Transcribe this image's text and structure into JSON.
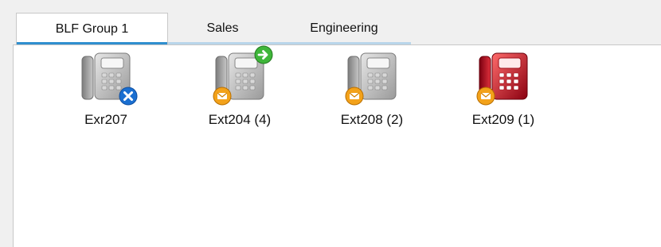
{
  "tabs": [
    {
      "label": "BLF Group 1",
      "active": true
    },
    {
      "label": "Sales",
      "active": false
    },
    {
      "label": "Engineering",
      "active": false
    }
  ],
  "extensions": [
    {
      "label": "Exr207",
      "phone_color": "grey",
      "icons": [
        "phone-icon",
        "offline-x-badge-icon"
      ]
    },
    {
      "label": "Ext204 (4)",
      "phone_color": "grey",
      "icons": [
        "phone-icon",
        "voicemail-badge-icon",
        "forward-arrow-badge-icon"
      ]
    },
    {
      "label": "Ext208 (2)",
      "phone_color": "grey",
      "icons": [
        "phone-icon",
        "voicemail-badge-icon"
      ]
    },
    {
      "label": "Ext209 (1)",
      "phone_color": "red",
      "icons": [
        "phone-icon",
        "voicemail-badge-icon"
      ]
    }
  ],
  "colors": {
    "background": "#f0f0f0",
    "panel": "#ffffff",
    "tab_active_underline": "#2f8fcf",
    "tab_inactive_underline": "#b9d6ea",
    "phone_grey": "#bfbfbf",
    "phone_red": "#c0001a",
    "badge_blue": "#1a6fd1",
    "badge_green": "#3fb63a",
    "badge_orange": "#f3a21a"
  }
}
